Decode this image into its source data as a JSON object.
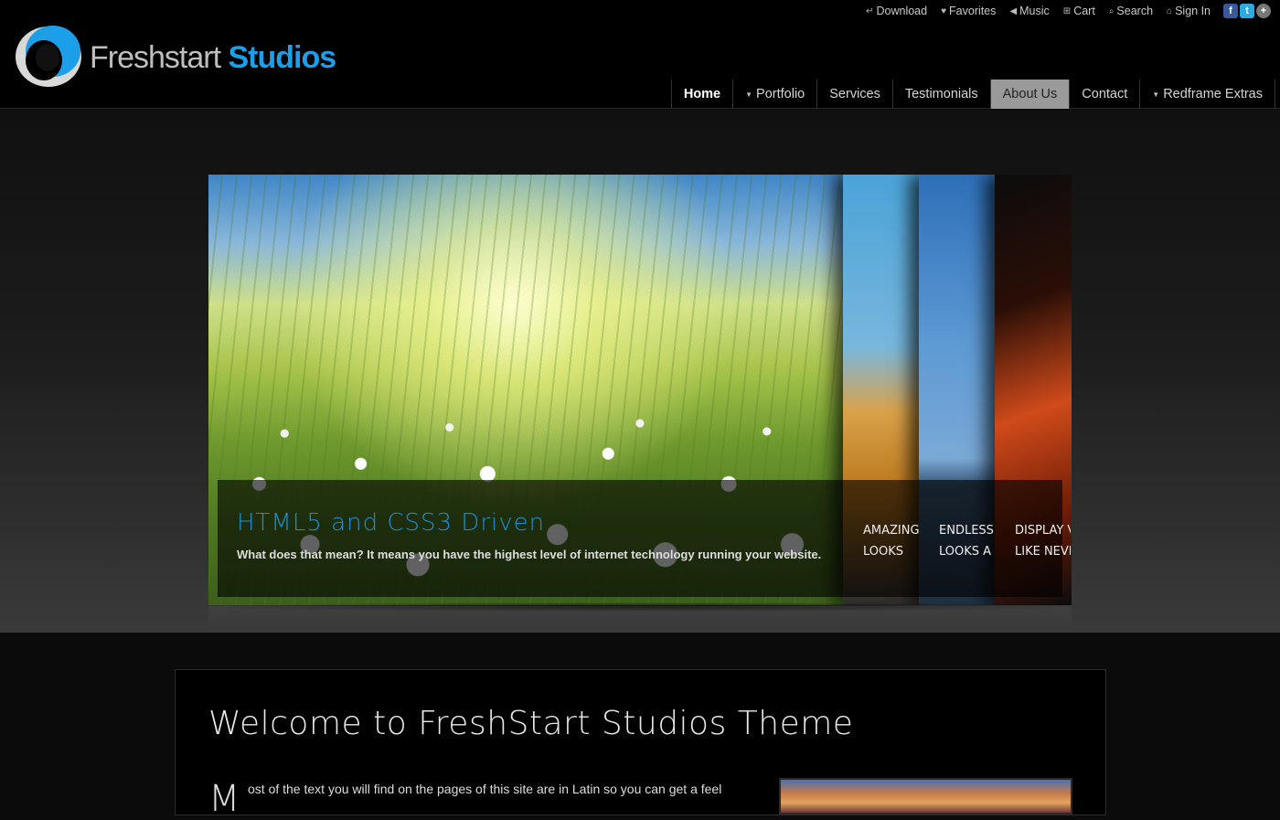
{
  "brand": {
    "word1": "Freshstart",
    "word2": "Studios"
  },
  "topbar": [
    {
      "icon": "download-icon",
      "glyph": "↵",
      "label": "Download"
    },
    {
      "icon": "heart-icon",
      "glyph": "♥",
      "label": "Favorites"
    },
    {
      "icon": "speaker-icon",
      "glyph": "◀",
      "label": "Music"
    },
    {
      "icon": "cart-icon",
      "glyph": "⊞",
      "label": "Cart"
    },
    {
      "icon": "search-icon",
      "glyph": "⌕",
      "label": "Search"
    },
    {
      "icon": "home-icon",
      "glyph": "⌂",
      "label": "Sign In"
    }
  ],
  "social": [
    {
      "icon": "facebook-icon",
      "glyph": "f"
    },
    {
      "icon": "twitter-icon",
      "glyph": "t"
    },
    {
      "icon": "plus-icon",
      "glyph": "+"
    }
  ],
  "nav": [
    {
      "label": "Home",
      "state": "active",
      "dropdown": false
    },
    {
      "label": "Portfolio",
      "state": "",
      "dropdown": true
    },
    {
      "label": "Services",
      "state": "",
      "dropdown": false
    },
    {
      "label": "Testimonials",
      "state": "",
      "dropdown": false
    },
    {
      "label": "About Us",
      "state": "hover",
      "dropdown": false
    },
    {
      "label": "Contact",
      "state": "",
      "dropdown": false
    },
    {
      "label": "Redframe Extras",
      "state": "",
      "dropdown": true
    }
  ],
  "slider": {
    "main_title": "HTML5 and CSS3 Driven",
    "main_subtitle": "What does that mean? It means you have the highest level of internet technology running your website.",
    "thumbs": [
      {
        "line1": "AMAZING",
        "line2": "LOOKS"
      },
      {
        "line1": "ENDLESS P",
        "line2": "LOOKS A"
      },
      {
        "line1": "DISPLAY V",
        "line2": "LIKE NEVE"
      }
    ]
  },
  "content": {
    "heading": "Welcome to FreshStart Studios Theme",
    "dropcap": "M",
    "paragraph": "ost of the text you will find on the pages of this site are in Latin so you can get a feel"
  },
  "colors": {
    "accent": "#1d9ee8",
    "nav_hover": "#9a9a9a",
    "background": "#0b0b0b"
  }
}
